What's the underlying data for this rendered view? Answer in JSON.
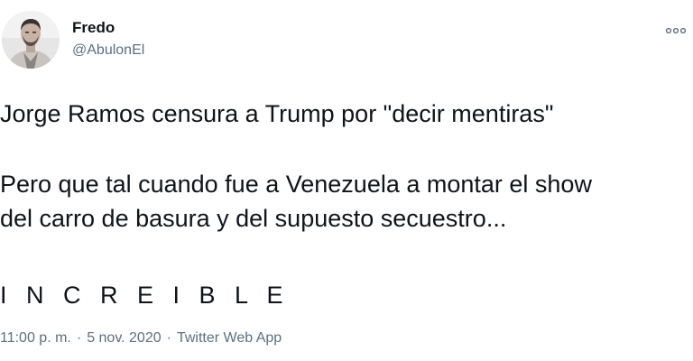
{
  "author": {
    "name": "Fredo",
    "handle": "@AbulonEl"
  },
  "icons": {
    "avatar": "profile-photo",
    "more": "more-options-icon"
  },
  "tweet": {
    "lines": [
      "Jorge Ramos censura a Trump por \"decir mentiras\"",
      "Pero que tal cuando fue a Venezuela a montar el show",
      "del carro de basura y del supuesto secuestro...",
      "I N C R E I B L E"
    ]
  },
  "meta": {
    "time": "11:00 p. m.",
    "date": "5 nov. 2020",
    "source": "Twitter Web App",
    "separator": "·"
  },
  "colors": {
    "text": "#0f1419",
    "secondary": "#5b7083",
    "background": "#ffffff"
  }
}
